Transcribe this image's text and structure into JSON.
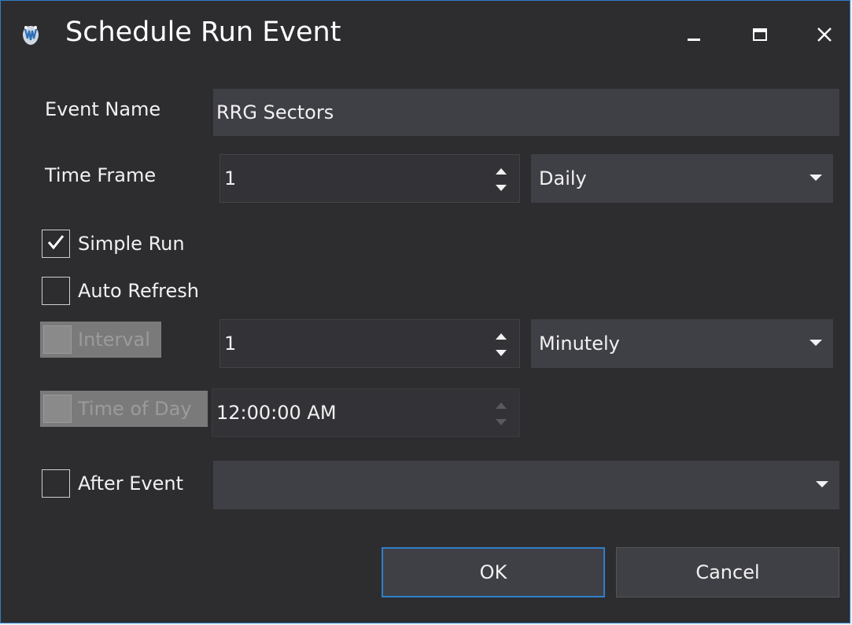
{
  "window": {
    "title": "Schedule Run Event",
    "icon": "app-logo-icon",
    "controls": [
      "minimize-icon",
      "maximize-icon",
      "close-icon"
    ]
  },
  "form": {
    "event_name": {
      "label": "Event Name",
      "value": "RRG Sectors"
    },
    "time_frame": {
      "label": "Time Frame",
      "count": "1",
      "period": "Daily"
    },
    "simple_run": {
      "label": "Simple Run",
      "checked": true
    },
    "auto_refresh": {
      "label": "Auto Refresh",
      "checked": false
    },
    "interval": {
      "label": "Interval",
      "enabled": false,
      "count": "1",
      "period": "Minutely"
    },
    "time_of_day": {
      "label": "Time of Day",
      "enabled": false,
      "value": "12:00:00 AM"
    },
    "after_event": {
      "label": "After Event",
      "checked": false,
      "value": ""
    }
  },
  "buttons": {
    "ok": "OK",
    "cancel": "Cancel"
  },
  "colors": {
    "background": "#2d2d30",
    "field": "#3f3f46",
    "accent": "#2f7fc9",
    "text": "#f1f1f1"
  }
}
